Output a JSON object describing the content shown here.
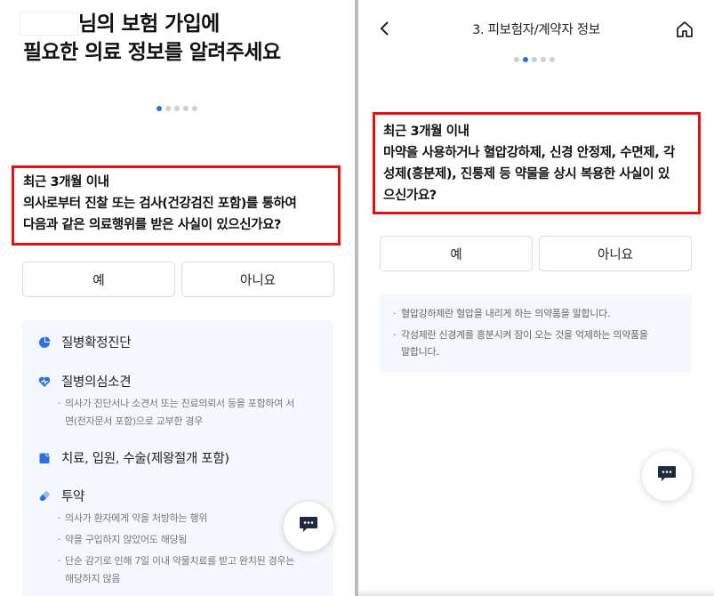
{
  "left": {
    "heading_line1": "님의 보험 가입에",
    "heading_line2": "필요한 의료 정보를 알려주세요",
    "question_line1": "최근 3개월 이내",
    "question_line2": "의사로부터 진찰 또는 검사(건강검진 포함)를 통하여",
    "question_line3": "다음과 같은 의료행위를 받은 사실이 있으신가요?",
    "yes_label": "예",
    "no_label": "아니요",
    "progress": {
      "current_step": 1,
      "total_steps": 5
    },
    "items": [
      {
        "label": "질병확정진단",
        "icon": "pie-chart-icon"
      },
      {
        "label": "질병의심소견",
        "icon": "heart-pulse-icon",
        "notes": [
          "의사가 진단서나 소견서 또는 진료의뢰서 등을 포함하여 서",
          "면(전자문서 포함)으로 교부한 경우"
        ]
      },
      {
        "label": "치료, 입원, 수술(제왕절개 포함)",
        "icon": "clipboard-icon"
      },
      {
        "label": "투약",
        "icon": "pill-icon",
        "notes": [
          "의사가 환자에게 약을 처방하는 행위",
          "약을 구입하지 않았어도 해당됨",
          "단순 감기로 인해 7일 이내 약물치료를 받고 완치된 경우는",
          "해당하지 않음"
        ]
      }
    ]
  },
  "right": {
    "title": "3. 피보험자/계약자 정보",
    "progress": {
      "current_step": 2,
      "total_steps": 5
    },
    "question_line1": "최근 3개월 이내",
    "question_line2": "마약을 사용하거나 혈압강하제, 신경 안정제, 수면제, 각",
    "question_line3": "성제(흥분제), 진통제 등 약물을 상시 복용한 사실이 있",
    "question_line4": "으신가요?",
    "yes_label": "예",
    "no_label": "아니요",
    "info_line1": "혈압강하제란 혈압을 내리게 하는 의약품을 말합니다.",
    "info_line2": "각성제란 신경계를 흥분시켜 잠이 오는 것을 억제하는 의약품을",
    "info_line3": "말합니다."
  },
  "colors": {
    "highlight": "#e01010",
    "accent": "#2f6fe0",
    "card": "#f4f8fc"
  }
}
